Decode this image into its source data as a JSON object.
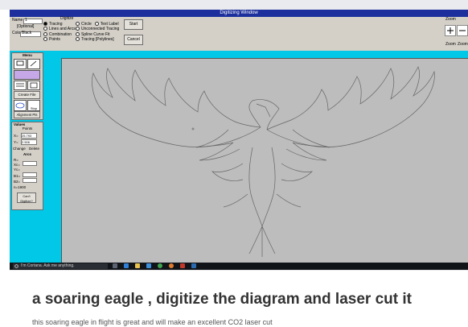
{
  "window": {
    "title": "Digitizing Window"
  },
  "toolbar": {
    "name_label": "Name",
    "name_value": "1",
    "optional_label": "[Optional]",
    "color_label": "Color",
    "color_value": "Black",
    "digitize_heading": "Digitize",
    "options": [
      {
        "label": "Tracing",
        "selected": true
      },
      {
        "label": "Lines and Arcs",
        "selected": false
      },
      {
        "label": "Combination",
        "selected": false
      },
      {
        "label": "Points",
        "selected": false
      },
      {
        "label": "Circle",
        "selected": false
      },
      {
        "label": "Unconnected Tracing",
        "selected": false
      },
      {
        "label": "Spline Curve Fit",
        "selected": false
      },
      {
        "label": "Tracing [Polylines]",
        "selected": false
      },
      {
        "label": "Text Label",
        "selected": false
      }
    ],
    "start_label": "Start",
    "cancel_label": "Cancel",
    "zoom_heading": "Zoom",
    "zoom_in_label": "Zoom",
    "zoom_out_label": "Zoom"
  },
  "left_panel": {
    "menu_heading": "Menu",
    "create_file_label": "Create File",
    "stop_label": "Stop",
    "alignment_pts_label": "Alignment Pts",
    "values_heading": "Values",
    "points_label": "Points",
    "x_label": "X=",
    "x_value": "25.793",
    "y_label": "Y=",
    "y_value": "2.506",
    "change_label": "Change",
    "delete_label": "Delete",
    "arcs_heading": "Arcs",
    "r_label": "R=",
    "xc_label": "Xc=",
    "yc_label": "Yc=",
    "b1_label": "B1=",
    "b2_label": "B2=",
    "units_label": "n=1900",
    "cant_digitize_label": "Can't Digitize?"
  },
  "taskbar": {
    "search_placeholder": "I'm Cortana. Ask me anything.",
    "icons": [
      "task-view-icon",
      "edge-icon",
      "file-explorer-icon",
      "store-icon",
      "chrome-icon",
      "firefox-icon",
      "app-icon",
      "mail-icon"
    ]
  },
  "article": {
    "headline": "a soaring eagle , digitize the diagram and laser cut it",
    "subline": "this soaring eagle in flight is great and will make an excellent CO2 laser cut"
  },
  "colors": {
    "titlebar": "#1c2f9c",
    "panel_cyan": "#00c8e6",
    "canvas_gray": "#bdbdbd",
    "taskbar": "#101318"
  }
}
